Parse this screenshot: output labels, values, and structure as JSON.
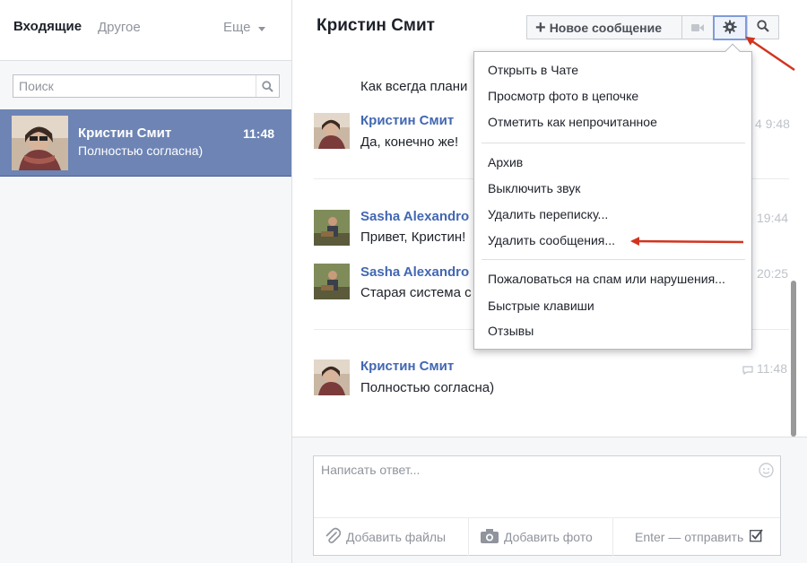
{
  "sidebar": {
    "tabs": {
      "inbox": "Входящие",
      "other": "Другое",
      "more": "Еще"
    },
    "search": {
      "placeholder": "Поиск"
    },
    "conversation": {
      "name": "Кристин Смит",
      "time": "11:48",
      "preview": "Полностью согласна)"
    }
  },
  "header": {
    "title": "Кристин Смит",
    "new_message_label": "Новое сообщение"
  },
  "messages": [
    {
      "text": "Как всегда плани"
    },
    {
      "name": "Кристин Смит",
      "text": "Да, конечно же!",
      "time": "4 9:48"
    },
    {
      "name": "Sasha Alexandro",
      "text": "Привет, Кристин!",
      "time": "19:44"
    },
    {
      "name": "Sasha Alexandro",
      "text": "Старая система с",
      "time": "20:25"
    },
    {
      "name": "Кристин Смит",
      "text": "Полностью согласна)",
      "time": "11:48"
    }
  ],
  "menu": {
    "items": [
      "Открыть в Чате",
      "Просмотр фото в цепочке",
      "Отметить как непрочитанное",
      "Архив",
      "Выключить звук",
      "Удалить переписку...",
      "Удалить сообщения...",
      "Пожаловаться на спам или нарушения...",
      "Быстрые клавиши",
      "Отзывы"
    ]
  },
  "composer": {
    "placeholder": "Написать ответ...",
    "add_files": "Добавить файлы",
    "add_photo": "Добавить фото",
    "enter_send": "Enter — отправить"
  },
  "colors": {
    "accent_blue": "#4267b2",
    "selected_row": "#6d84b4",
    "annotation_red": "#d2341f"
  },
  "icons": [
    "search-icon",
    "plus-icon",
    "video-icon",
    "gear-icon",
    "emoji-icon",
    "paperclip-icon",
    "camera-icon",
    "checkbox-icon",
    "chevron-down-icon"
  ]
}
